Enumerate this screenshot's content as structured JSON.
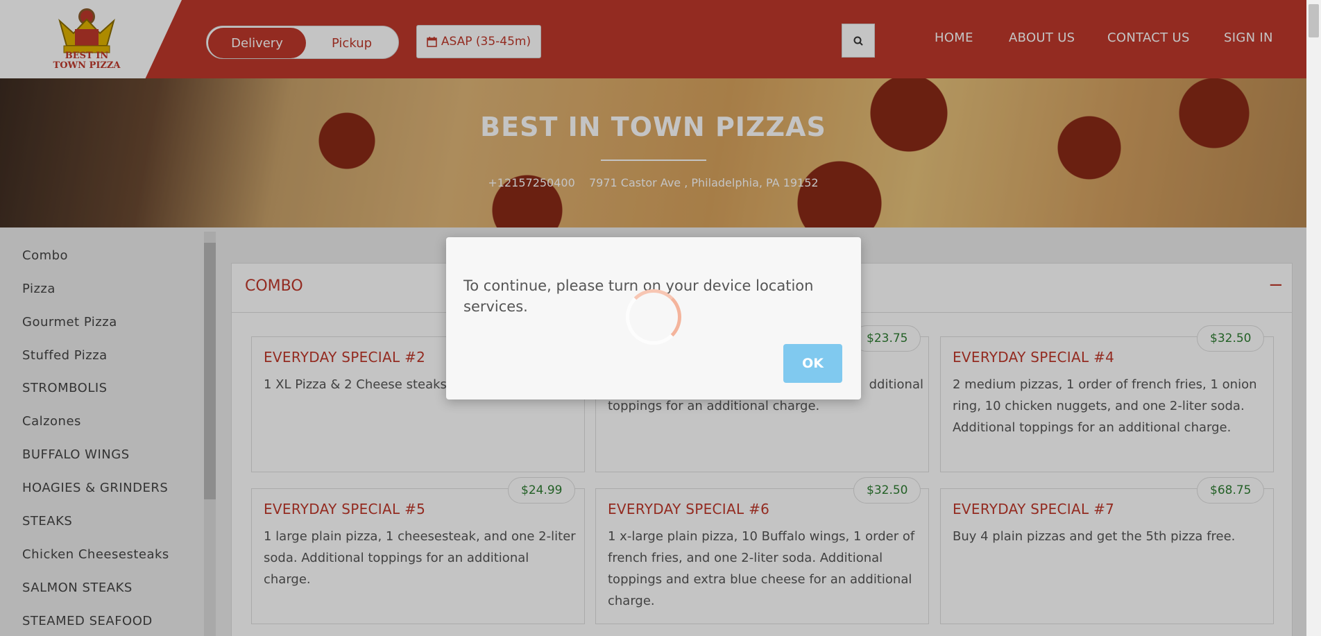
{
  "header": {
    "logo_text": "BEST IN TOWN PIZZA",
    "order_type": {
      "delivery": "Delivery",
      "pickup": "Pickup"
    },
    "time_button": "ASAP (35-45m)",
    "nav": [
      "HOME",
      "ABOUT US",
      "CONTACT US",
      "SIGN IN"
    ],
    "colors": {
      "brand": "#c0392b"
    }
  },
  "hero": {
    "title": "BEST IN TOWN PIZZAS",
    "phone": "+12157250400",
    "address": "7971 Castor Ave , Philadelphia, PA 19152"
  },
  "sidebar": {
    "items": [
      "Combo",
      "Pizza",
      "Gourmet Pizza",
      "Stuffed Pizza",
      "STROMBOLIS",
      "Calzones",
      "BUFFALO WINGS",
      "HOAGIES & GRINDERS",
      "STEAKS",
      "Chicken Cheesesteaks",
      "SALMON STEAKS",
      "STEAMED SEAFOOD"
    ]
  },
  "menu": {
    "section_title": "COMBO",
    "toggle": "−",
    "cards": [
      {
        "title": "EVERYDAY SPECIAL #2",
        "desc": "1 XL Pizza & 2 Cheese steaks",
        "price": ""
      },
      {
        "title": "",
        "desc": "toppings for an additional charge.",
        "desc_right": "dditional",
        "price": "$23.75"
      },
      {
        "title": "EVERYDAY SPECIAL #4",
        "desc": "2 medium pizzas, 1 order of french fries, 1 onion ring, 10 chicken nuggets, and one 2-liter soda. Additional toppings for an additional charge.",
        "price": "$32.50"
      },
      {
        "title": "EVERYDAY SPECIAL #5",
        "desc": "1 large plain pizza, 1 cheesesteak, and one 2-liter soda. Additional toppings for an additional charge.",
        "price": "$24.99"
      },
      {
        "title": "EVERYDAY SPECIAL #6",
        "desc": "1 x-large plain pizza, 10 Buffalo wings, 1 order of french fries, and one 2-liter soda. Additional toppings and extra blue cheese for an additional charge.",
        "price": "$32.50"
      },
      {
        "title": "EVERYDAY SPECIAL #7",
        "desc": "Buy 4 plain pizzas and get the 5th pizza free.",
        "price": "$68.75"
      }
    ]
  },
  "modal": {
    "message": "To continue, please turn on your device location services.",
    "ok": "OK"
  }
}
